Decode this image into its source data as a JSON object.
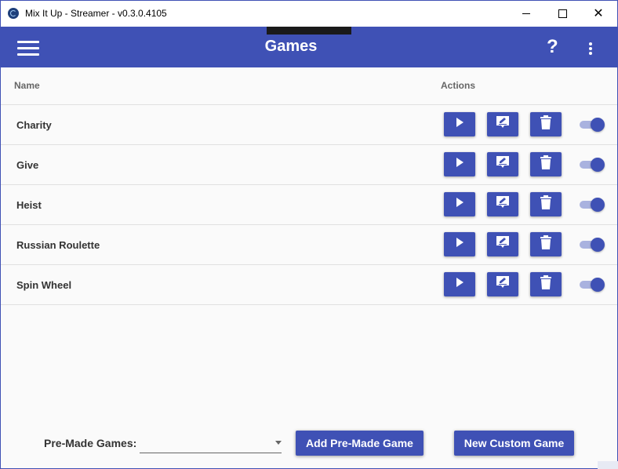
{
  "window": {
    "title": "Mix It Up - Streamer - v0.3.0.4105"
  },
  "toolbar": {
    "title": "Games",
    "help_label": "?"
  },
  "table": {
    "headers": {
      "name": "Name",
      "actions": "Actions"
    },
    "rows": [
      {
        "name": "Charity",
        "enabled": true
      },
      {
        "name": "Give",
        "enabled": true
      },
      {
        "name": "Heist",
        "enabled": true
      },
      {
        "name": "Russian Roulette",
        "enabled": true
      },
      {
        "name": "Spin Wheel",
        "enabled": true
      }
    ]
  },
  "footer": {
    "premade_label": "Pre-Made Games:",
    "premade_value": "",
    "add_button": "Add Pre-Made Game",
    "custom_button": "New Custom Game"
  },
  "colors": {
    "primary": "#3f51b5",
    "toggle_track": "#a9b2df"
  },
  "icons": [
    "app-icon",
    "menu-icon",
    "help-icon",
    "more-vert-icon",
    "play-icon",
    "edit-icon",
    "trash-icon",
    "dropdown-arrow-icon"
  ]
}
